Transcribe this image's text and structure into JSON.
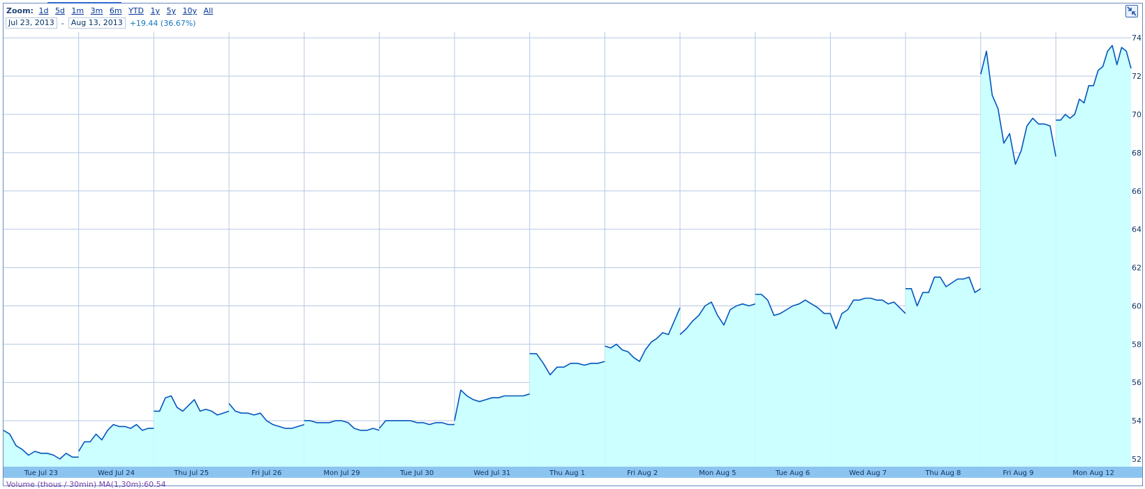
{
  "zoom": {
    "label": "Zoom:",
    "options": [
      "1d",
      "5d",
      "1m",
      "3m",
      "6m",
      "YTD",
      "1y",
      "5y",
      "10y",
      "All"
    ]
  },
  "range": {
    "start": "Jul 23, 2013",
    "separator": "-",
    "end": "Aug 13, 2013",
    "change": "+19.44 (36.67%)"
  },
  "volume_label": "Volume (thous / 30min) MA(1,30m):60.54",
  "icons": {
    "fullscreen": "collapse-arrows-icon"
  },
  "colors": {
    "line": "#0055bb",
    "fill": "#ccffff",
    "grid": "#b4c8e4",
    "axis_band": "#8cc4f0"
  },
  "chart_data": {
    "type": "area",
    "ylim": [
      51.6,
      74.3
    ],
    "yticks": [
      52,
      54,
      56,
      58,
      60,
      62,
      64,
      66,
      68,
      70,
      72,
      74
    ],
    "grid": true,
    "days": [
      "Tue Jul 23",
      "Wed Jul 24",
      "Thu Jul 25",
      "Fri Jul 26",
      "Mon Jul 29",
      "Tue Jul 30",
      "Wed Jul 31",
      "Thu Aug 1",
      "Fri Aug 2",
      "Mon Aug 5",
      "Tue Aug 6",
      "Wed Aug 7",
      "Thu Aug 8",
      "Fri Aug 9",
      "Mon Aug 12"
    ],
    "series": [
      {
        "values": [
          [
            53.5,
            53.3,
            52.7,
            52.5,
            52.2,
            52.4,
            52.3,
            52.3,
            52.2,
            52.0,
            52.3,
            52.1,
            52.1
          ],
          [
            52.4,
            52.9,
            52.9,
            53.3,
            53.0,
            53.5,
            53.8,
            53.7,
            53.7,
            53.6,
            53.8,
            53.5,
            53.6,
            53.6
          ],
          [
            54.5,
            54.5,
            55.2,
            55.3,
            54.7,
            54.5,
            54.8,
            55.1,
            54.5,
            54.6,
            54.5,
            54.3,
            54.4,
            54.5
          ],
          [
            54.9,
            54.5,
            54.4,
            54.4,
            54.3,
            54.4,
            54.0,
            53.8,
            53.7,
            53.6,
            53.6,
            53.7,
            53.8
          ],
          [
            54.0,
            54.0,
            53.9,
            53.9,
            53.9,
            54.0,
            54.0,
            53.9,
            53.6,
            53.5,
            53.5,
            53.6,
            53.5
          ],
          [
            53.6,
            54.0,
            54.0,
            54.0,
            54.0,
            54.0,
            53.9,
            53.9,
            53.8,
            53.9,
            53.9,
            53.8,
            53.8
          ],
          [
            54.0,
            55.6,
            55.3,
            55.1,
            55.0,
            55.1,
            55.2,
            55.2,
            55.3,
            55.3,
            55.3,
            55.3,
            55.4
          ],
          [
            57.5,
            57.5,
            57.0,
            56.4,
            56.8,
            56.8,
            57.0,
            57.0,
            56.9,
            57.0,
            57.0,
            57.1
          ],
          [
            57.9,
            57.8,
            58.0,
            57.7,
            57.6,
            57.3,
            57.1,
            57.7,
            58.1,
            58.3,
            58.6,
            58.5,
            59.2,
            59.9
          ],
          [
            58.5,
            58.8,
            59.2,
            59.5,
            60.0,
            60.2,
            59.5,
            59.0,
            59.8,
            60.0,
            60.1,
            60.0,
            60.1
          ],
          [
            60.6,
            60.6,
            60.3,
            59.5,
            59.6,
            59.8,
            60.0,
            60.1,
            60.3,
            60.1,
            59.9,
            59.6,
            59.6
          ],
          [
            59.6,
            58.8,
            59.6,
            59.8,
            60.3,
            60.3,
            60.4,
            60.4,
            60.3,
            60.3,
            60.1,
            60.2,
            59.9,
            59.6
          ],
          [
            60.9,
            60.9,
            60.0,
            60.7,
            60.7,
            61.5,
            61.5,
            61.0,
            61.2,
            61.4,
            61.4,
            61.5,
            60.7,
            60.9
          ],
          [
            72.1,
            73.3,
            71.0,
            70.3,
            68.5,
            69.0,
            67.4,
            68.1,
            69.4,
            69.8,
            69.5,
            69.5,
            69.4,
            67.8
          ],
          [
            69.7,
            69.7,
            70.0,
            69.8,
            70.0,
            70.8,
            70.6,
            71.5,
            71.5,
            72.3,
            72.5,
            73.3,
            73.6,
            72.6,
            73.5,
            73.3,
            72.4
          ]
        ]
      }
    ]
  }
}
